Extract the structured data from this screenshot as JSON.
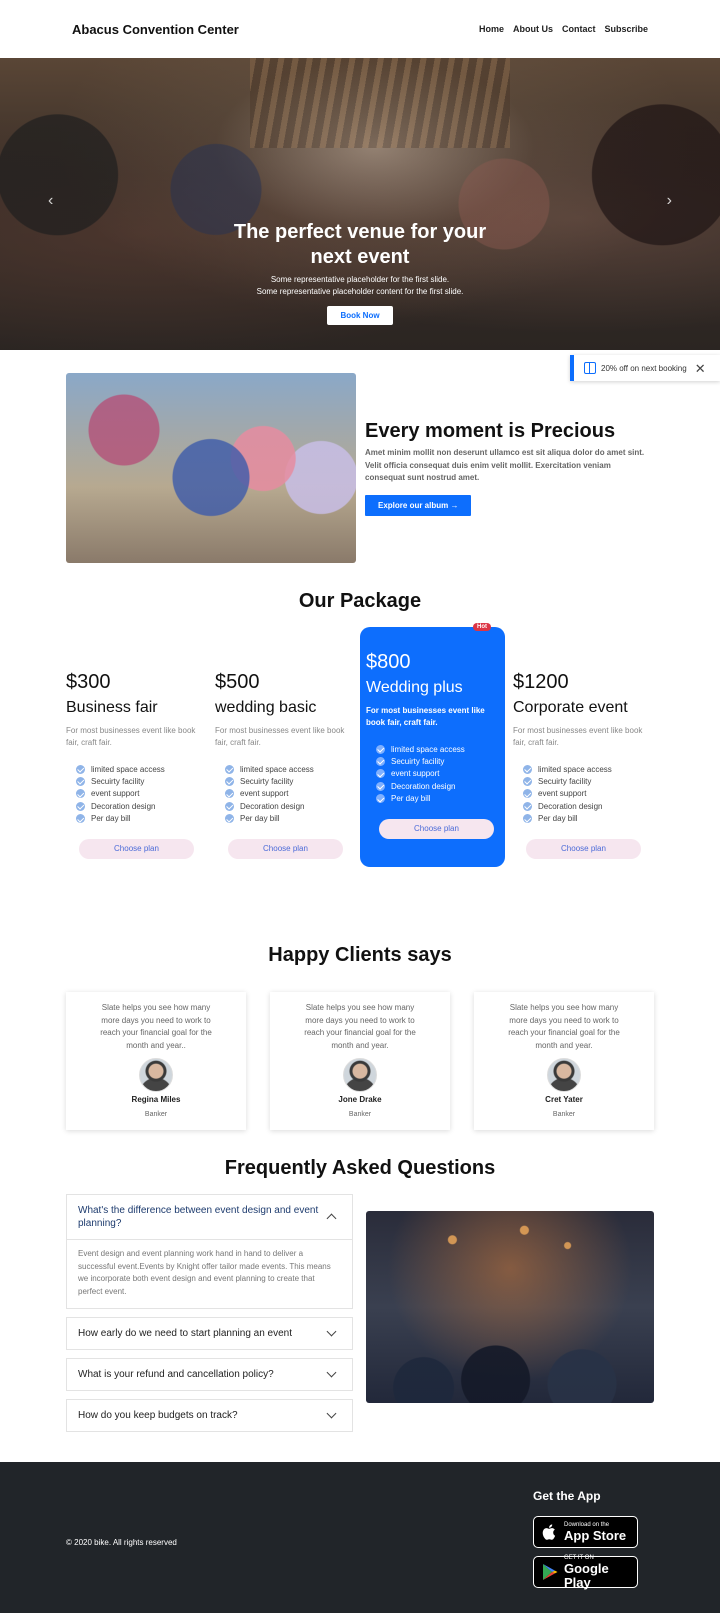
{
  "nav": {
    "brand": "Abacus Convention Center",
    "links": [
      "Home",
      "About Us",
      "Contact",
      "Subscribe"
    ]
  },
  "hero": {
    "title": "The perfect venue for your next event",
    "subtitle_1": "Some representative placeholder for the first slide.",
    "subtitle_2": "Some representative placeholder content for the first slide.",
    "button": "Book Now",
    "prev_icon": "chevron-left-icon",
    "next_icon": "chevron-right-icon",
    "active_slide": 1,
    "slide_count": 4
  },
  "promo": {
    "icon": "gift-icon",
    "text": "20% off on next booking",
    "close_icon": "close-icon"
  },
  "about": {
    "title": "Every moment is Precious",
    "description": "Amet minim mollit non deserunt ullamco est sit aliqua dolor do amet sint. Velit officia consequat duis enim velit mollit. Exercitation veniam consequat sunt nostrud amet.",
    "button": "Explore our album →"
  },
  "packages": {
    "title": "Our Package",
    "hot_badge": "Hot",
    "items": [
      {
        "price": "$300",
        "name": "Business fair",
        "desc": "For most businesses event like book fair, craft fair.",
        "features": [
          "limited space access",
          "Secuirty facility",
          "event support",
          "Decoration design",
          "Per day bill"
        ],
        "button": "Choose plan",
        "featured": false
      },
      {
        "price": "$500",
        "name": "wedding basic",
        "desc": "For most businesses event like book fair, craft fair.",
        "features": [
          "limited space access",
          "Secuirty facility",
          "event support",
          "Decoration design",
          "Per day bill"
        ],
        "button": "Choose plan",
        "featured": false
      },
      {
        "price": "$800",
        "name": "Wedding plus",
        "desc": "For most businesses event like book fair, craft fair.",
        "features": [
          "limited space access",
          "Secuirty facility",
          "event support",
          "Decoration design",
          "Per day bill"
        ],
        "button": "Choose plan",
        "featured": true
      },
      {
        "price": "$1200",
        "name": "Corporate event",
        "desc": "For most businesses event like book fair, craft fair.",
        "features": [
          "limited space access",
          "Secuirty facility",
          "event support",
          "Decoration design",
          "Per day bill"
        ],
        "button": "Choose plan",
        "featured": false
      }
    ]
  },
  "clients": {
    "title": "Happy Clients says",
    "items": [
      {
        "quote": "Slate helps you see how many more days you need to work to reach your financial goal for the month and year..",
        "name": "Regina Miles",
        "role": "Banker"
      },
      {
        "quote": "Slate helps you see how many more days you need to work to reach your financial goal for the month and year.",
        "name": "Jone Drake",
        "role": "Banker"
      },
      {
        "quote": "Slate helps you see how many more days you need to work to reach your financial goal for the month and year.",
        "name": "Cret Yater",
        "role": "Banker"
      }
    ]
  },
  "faq": {
    "title": "Frequently Asked Questions",
    "items": [
      {
        "question": "What's the difference between event design and event planning?",
        "answer": "Event design and event planning work hand in hand to deliver a successful event.Events by Knight offer tailor made events. This means we incorporate both event design and event planning to create that perfect event.",
        "open": true
      },
      {
        "question": "How early do we need to start planning an event",
        "open": false
      },
      {
        "question": "What is your refund and cancellation policy?",
        "open": false
      },
      {
        "question": "How do you keep budgets on track?",
        "open": false
      }
    ]
  },
  "footer": {
    "copyright": "© 2020 bike. All rights reserved",
    "get_app": "Get the App",
    "app_store_small": "Download on the",
    "app_store_big": "App Store",
    "google_small": "GET IT ON",
    "google_big": "Google Play"
  },
  "colors": {
    "primary": "#0d6efd",
    "footer_bg": "#212529",
    "hot_badge": "#dc3545",
    "choose_plan_bg": "#f6e6ef"
  }
}
